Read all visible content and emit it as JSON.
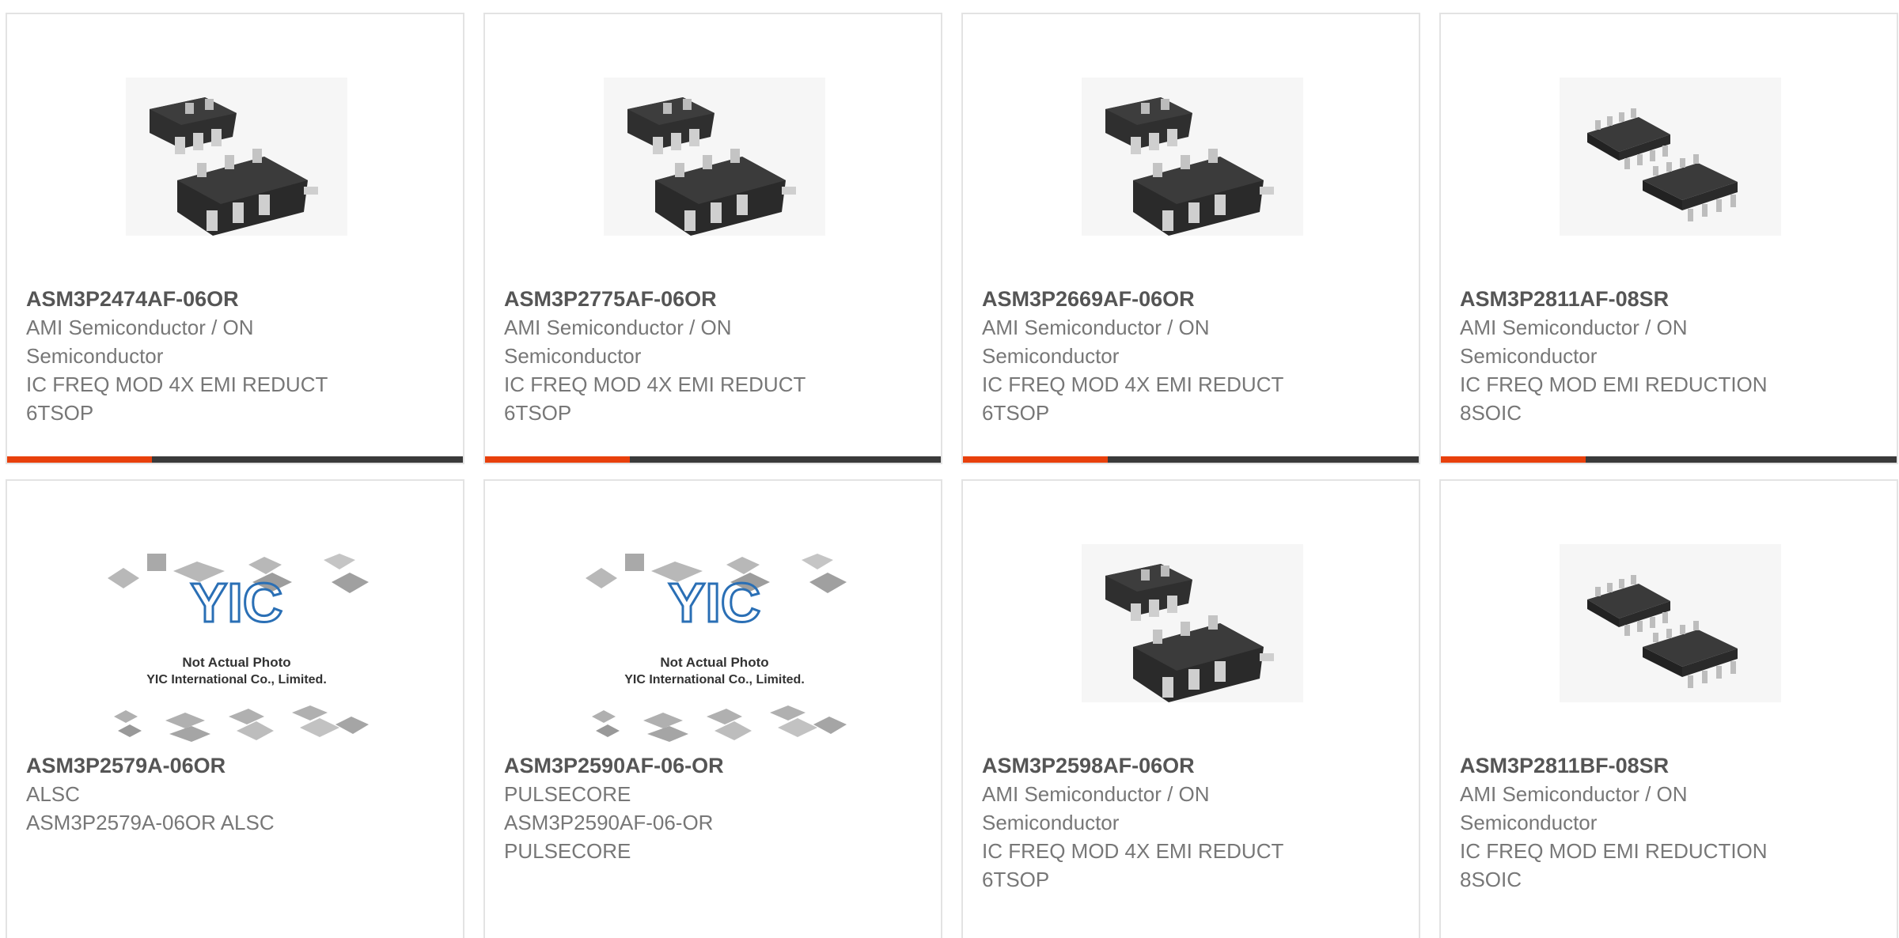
{
  "colors": {
    "accent": "#e8400c",
    "bar": "#3a3a3a",
    "border": "#e3e3e3",
    "title": "#555555",
    "text": "#777777"
  },
  "products": [
    {
      "part_number": "ASM3P2474AF-06OR",
      "manufacturer_line1": "AMI Semiconductor / ON",
      "manufacturer_line2": "Semiconductor",
      "description_line1": "IC FREQ MOD 4X EMI REDUCT",
      "description_line2": "6TSOP",
      "image": "tsop6-chip-photo"
    },
    {
      "part_number": "ASM3P2775AF-06OR",
      "manufacturer_line1": "AMI Semiconductor / ON",
      "manufacturer_line2": "Semiconductor",
      "description_line1": "IC FREQ MOD 4X EMI REDUCT",
      "description_line2": "6TSOP",
      "image": "tsop6-chip-photo"
    },
    {
      "part_number": "ASM3P2669AF-06OR",
      "manufacturer_line1": "AMI Semiconductor / ON",
      "manufacturer_line2": "Semiconductor",
      "description_line1": "IC FREQ MOD 4X EMI REDUCT",
      "description_line2": "6TSOP",
      "image": "tsop6-chip-photo"
    },
    {
      "part_number": "ASM3P2811AF-08SR",
      "manufacturer_line1": "AMI Semiconductor / ON",
      "manufacturer_line2": "Semiconductor",
      "description_line1": "IC FREQ MOD EMI REDUCTION",
      "description_line2": "8SOIC",
      "image": "soic8-chip-photo"
    },
    {
      "part_number": "ASM3P2579A-06OR",
      "manufacturer_line1": "ALSC",
      "manufacturer_line2": "",
      "description_line1": "ASM3P2579A-06OR ALSC",
      "description_line2": "",
      "image": "placeholder-not-actual-photo"
    },
    {
      "part_number": "ASM3P2590AF-06-OR",
      "manufacturer_line1": "PULSECORE",
      "manufacturer_line2": "",
      "description_line1": "ASM3P2590AF-06-OR",
      "description_line2": "PULSECORE",
      "image": "placeholder-not-actual-photo"
    },
    {
      "part_number": "ASM3P2598AF-06OR",
      "manufacturer_line1": "AMI Semiconductor / ON",
      "manufacturer_line2": "Semiconductor",
      "description_line1": "IC FREQ MOD 4X EMI REDUCT",
      "description_line2": "6TSOP",
      "image": "tsop6-chip-photo"
    },
    {
      "part_number": "ASM3P2811BF-08SR",
      "manufacturer_line1": "AMI Semiconductor / ON",
      "manufacturer_line2": "Semiconductor",
      "description_line1": "IC FREQ MOD EMI REDUCTION",
      "description_line2": "8SOIC",
      "image": "soic8-chip-photo"
    }
  ],
  "placeholder": {
    "logo_text": "YIC",
    "caption_line1": "Not Actual Photo",
    "caption_line2": "YIC International Co., Limited."
  }
}
